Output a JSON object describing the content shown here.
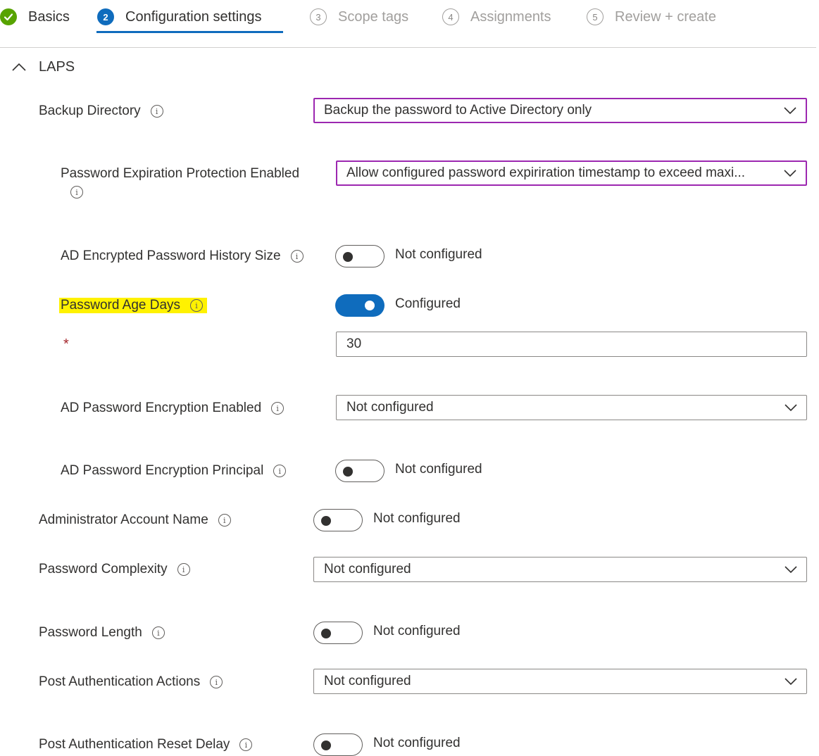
{
  "wizard": {
    "steps": [
      {
        "number": "",
        "label": "Basics",
        "state": "done"
      },
      {
        "number": "2",
        "label": "Configuration settings",
        "state": "active"
      },
      {
        "number": "3",
        "label": "Scope tags",
        "state": "pending"
      },
      {
        "number": "4",
        "label": "Assignments",
        "state": "pending"
      },
      {
        "number": "5",
        "label": "Review + create",
        "state": "pending"
      }
    ]
  },
  "section": {
    "title": "LAPS",
    "expanded": true
  },
  "settings": {
    "backup_directory": {
      "label": "Backup Directory",
      "value": "Backup the password to Active Directory only"
    },
    "password_expiration_protection": {
      "label": "Password Expiration Protection Enabled",
      "value": "Allow configured password expiriration timestamp to exceed maxi..."
    },
    "ad_encrypted_password_history_size": {
      "label": "AD Encrypted Password History Size",
      "toggle_on": false,
      "status": "Not configured"
    },
    "password_age_days": {
      "label": "Password Age Days",
      "toggle_on": true,
      "status": "Configured",
      "required_mark": "*",
      "value": "30"
    },
    "ad_password_encryption_enabled": {
      "label": "AD Password Encryption Enabled",
      "value": "Not configured"
    },
    "ad_password_encryption_principal": {
      "label": "AD Password Encryption Principal",
      "toggle_on": false,
      "status": "Not configured"
    },
    "administrator_account_name": {
      "label": "Administrator Account Name",
      "toggle_on": false,
      "status": "Not configured"
    },
    "password_complexity": {
      "label": "Password Complexity",
      "value": "Not configured"
    },
    "password_length": {
      "label": "Password Length",
      "toggle_on": false,
      "status": "Not configured"
    },
    "post_authentication_actions": {
      "label": "Post Authentication Actions",
      "value": "Not configured"
    },
    "post_authentication_reset_delay": {
      "label": "Post Authentication Reset Delay",
      "toggle_on": false,
      "status": "Not configured"
    }
  },
  "icons": {
    "info": "i"
  },
  "colors": {
    "accent": "#0f6cbd",
    "success": "#57a300",
    "highlight": "#fff200",
    "focus_border": "#9c27b0",
    "required": "#a4262c"
  }
}
